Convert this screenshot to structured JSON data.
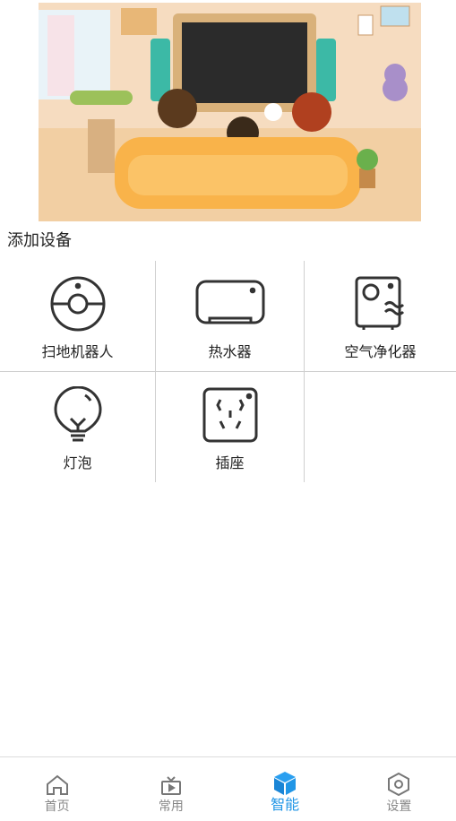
{
  "banner": {
    "image": "family-watching-tv-illustration"
  },
  "section": {
    "title": "添加设备"
  },
  "devices": [
    {
      "label": "扫地机器人",
      "icon": "robot-vacuum-icon"
    },
    {
      "label": "热水器",
      "icon": "water-heater-icon"
    },
    {
      "label": "空气净化器",
      "icon": "air-purifier-icon"
    },
    {
      "label": "灯泡",
      "icon": "light-bulb-icon"
    },
    {
      "label": "插座",
      "icon": "power-socket-icon"
    }
  ],
  "tabbar": {
    "tabs": [
      {
        "label": "首页",
        "icon": "home-icon",
        "active": false
      },
      {
        "label": "常用",
        "icon": "tv-icon",
        "active": false
      },
      {
        "label": "智能",
        "icon": "cube-icon",
        "active": true
      },
      {
        "label": "设置",
        "icon": "settings-icon",
        "active": false
      }
    ],
    "active_color": "#2196e6",
    "inactive_color": "#888888"
  }
}
